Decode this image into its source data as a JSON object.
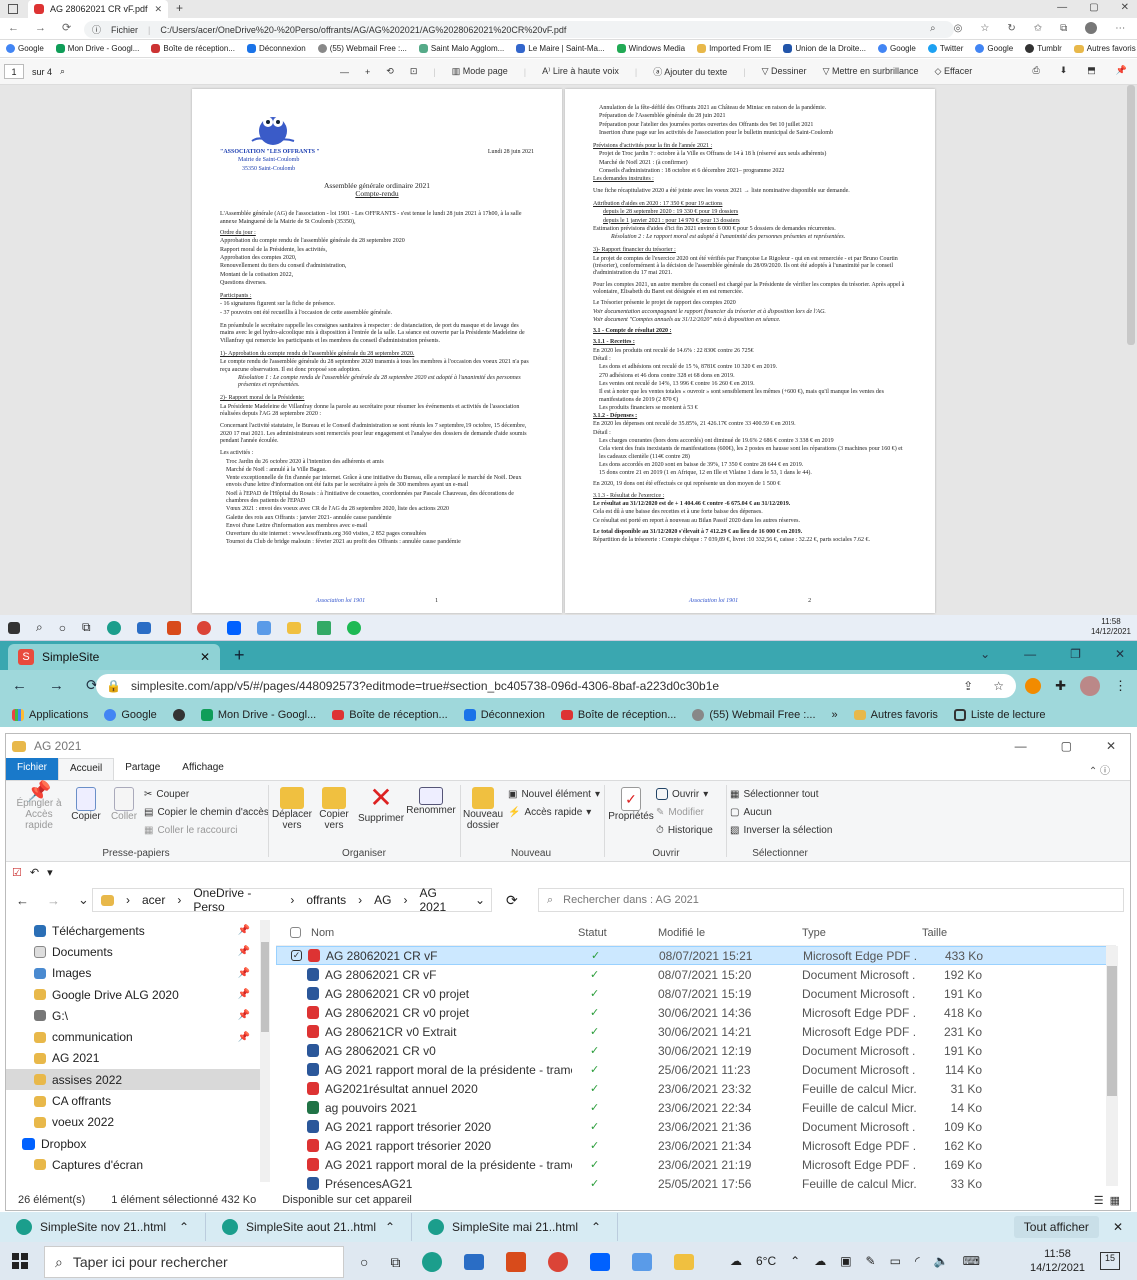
{
  "edge_window": {
    "tab_title": "AG 28062021 CR vF.pdf",
    "address_prefix": "Fichier",
    "url": "C:/Users/acer/OneDrive%20-%20Perso/offrants/AG/AG%202021/AG%2028062021%20CR%20vF.pdf",
    "favorites": [
      "Google",
      "Mon Drive - Googl...",
      "Boîte de réception...",
      "Déconnexion",
      "(55) Webmail Free :...",
      "Saint Malo Agglom...",
      "Le Maire | Saint-Ma...",
      "Windows Media",
      "Imported From IE",
      "Union de la Droite...",
      "Google",
      "Twitter",
      "Google",
      "Tumblr"
    ],
    "favorites_other": "Autres favoris",
    "pdf_toolbar": {
      "page_number": "1",
      "page_of": "sur 4",
      "mode": "Mode page",
      "read_aloud": "Lire à haute voix",
      "add_text": "Ajouter du texte",
      "draw": "Dessiner",
      "highlight": "Mettre en surbrillance",
      "erase": "Effacer"
    },
    "taskbar_time": "11:58",
    "taskbar_date": "14/12/2021"
  },
  "pdf_page1": {
    "org_name": "\"ASSOCIATION \"LES OFFRANTS \"",
    "org_line2": "Mairie de Saint-Coulomb",
    "org_line3": "35350  Saint-Coulomb",
    "date": "Lundi 28 juin 2021",
    "title": "Assemblée générale ordinaire 2021",
    "subtitle": "Compte-rendu",
    "intro": "L'Assemblée générale (AG) de l'association - loi 1901 - Les OFFRANTS - s'est tenue le lundi 28 juin 2021 à 17h00, à la salle annexe Mainguené de la Mairie de St Coulomb (35350),",
    "agenda_title": "Ordre du jour :",
    "agenda": [
      "Approbation du compte rendu de l'assemblée générale du 28 septembre 2020",
      "Rapport moral de la Présidente, les activités,",
      "Approbation des comptes 2020,",
      "Renouvellement du tiers du conseil d'administration,",
      "Montant de la cotisation 2022,",
      "Questions diverses."
    ],
    "participants_title": "Participants :",
    "participants": [
      "- 16 signatures figurent sur la fiche de présence.",
      "- 37 pouvoirs ont été recueillis à l'occasion de cette assemblée générale."
    ],
    "preamble": "En préambule le secrétaire rappelle les consignes sanitaires à respecter : de distanciation, de port du masque et de lavage des mains avec le gel hydro-alcoolique mis à disposition à l'entrée de la salle. La séance est ouverte par la Présidente Madeleine de Villanfray qui remercie les participants et les membres du conseil d'administration présents.",
    "s1_title": "1)- Approbation du compte rendu de l'assemblée générale du 28 septembre 2020.",
    "s1_text": "Le compte rendu de l'assemblée générale du 28 septembre 2020 transmis à tous les membres à l'occasion des voeux 2021 n'a pas reçu aucune observation. Il est donc proposé son adoption.",
    "s1_resolution": "Résolution 1 : Le compte rendu de l'assemblée générale du 28 septembre 2020 est adopté à l'unanimité des personnes présentes et représentées.",
    "s2_title": "2)- Rapport moral de la Présidente:",
    "s2_text": "La Présidente Madeleine de Villanfray donne la parole au secrétaire pour résumer les événements et activités de l'association réalisées depuis l'AG 28 septembre 2020 :",
    "s2_text2": "Concernant l'activité statutaire, le Bureau et le Conseil d'administration se sont réunis les 7 septembre,19 octobre, 15 décembre, 2020 17 mai 2021. Les administrateurs sont remerciés pour leur engagement et l'analyse des dossiers de demande d'aide soumis pendant l'année écoulée.",
    "activities_title": "Les activités :",
    "activities": [
      "Troc Jardin du 26 octobre 2020 à l'intention des adhérents et amis",
      "Marché de Noël : annulé à la Ville Bague.",
      "Vente exceptionnelle de fin d'année par internet. Grâce à une initiative du Bureau, elle a remplacé le marché de Noël. Deux envois d'une lettre d'information ont été faits par le secrétaire à près de 300 membres ayant un e-mail",
      "Noël à l'EPAD de l'Hôpital du Rosais : à l'initiative de cousettes, coordonnées par Pascale Chauveau, des décorations de chambres des patients de l'EPAD",
      "Vœux 2021 : envoi des voeux avec CR de l'AG du 28 septembre 2020, liste des actions 2020",
      "Galette des rois aux Offrants : janvier 2021- annulée cause pandémie",
      "Envoi d'une Lettre d'information aux membres avec e-mail",
      "Ouverture du site internet : www.lesoffrants.org  360 visites, 2 852 pages consultées",
      "Tournoi du Club de bridge malouin : février 2021 au profit des Offrants : annulée cause pandémie"
    ],
    "footer_left": "Association loi 1901",
    "footer_page": "1"
  },
  "pdf_page2": {
    "top_list": [
      "Annulation de la fête-défilé des Offrants 2021 au Château de Miniac en raison de la pandémie.",
      "Préparation de l'Assemblée générale du 28 juin 2021",
      "Préparation pour l'atelier des journées portes ouvertes des Offrants des 9et 10 juillet 2021",
      "Insertion d'une page sur les activités de l'association pour le bulletin municipal de Saint-Coulomb"
    ],
    "forecast_title": "Prévisions d'activités pour la fin de l'année 2021 :",
    "forecast": [
      "Projet de Troc jardin ? :  octobre à la Ville es Offrans de 14 à 18 h (réservé aux seuls adhérents)",
      "Marché de Noël 2021 : (à confirmer)",
      "Conseils d'administration : 18 octobre et 6 décembre 2021– programme 2022"
    ],
    "requests_title": "Les demandes instruites :",
    "requests_text": "Une fiche récapitulative 2020 a été jointe avec les voeux 2021 → liste nominative disponible sur  demande.",
    "aid_line": "Attribution d'aides en 2020 :         17 350 € pour 19 actions",
    "aid_a": "depuis le 28 septembre 2020 : 19 330 € pour 19 dossiers",
    "aid_b": "depuis le 1 janvier 2021 : pour 14 970 € pour 13 dossiers",
    "aid_c": "Estimation prévisions d'aides d'ici fin 2021 environ 6 000 € pour 5 dossiers de demandes récurrentes.",
    "resolution2": "Résolution 2 : Le rapport moral est adopté à l'unanimité des personnes présentes et représentées.",
    "s3_title": "3)- Rapport financier du trésorier :",
    "s3_text": "Le projet de comptes de l'exercice 2020 ont été vérifiés par Françoise Le Rigoleur - qui en est remerciée - et par Bruno Courtin (trésorier), conformément à la décision de l'assemblée générale du 28/09/2020. Ils ont été adoptés à l'unanimité par le conseil d'administration du 17 mai 2021.",
    "s3_text2": "Pour les comptes 2021, un autre membre du conseil est chargé par la Présidente de vérifier les comptes du trésorier. Après appel à volontaire, Elisabeth du Baret est désignée et en est remerciée.",
    "s3_text3": "Le Trésorier présente le projet de rapport des comptes 2020",
    "s3_it1": "Voir documentation accompagnant le rapport financier du trésorier et à disposition lors de l'AG.",
    "s3_it2": "Voir document \"Comptes annuels au 31/12/2020\" mis à disposition en séance.",
    "s31_title": "3.1 - Compte de résultat 2020 :",
    "s311_title": "3.1.1 - Recettes :",
    "s311_text": "En 2020 les produits ont reculé de 14.6% : 22 830€ contre 26 725€",
    "detail": "Détail :",
    "recettes": [
      "Les dons et adhésions ont reculé de 15 %, 8781€ contre 10 320 € en 2019.",
      "270 adhésions et 46 dons contre 328 et 68 dons en 2019.",
      "Les ventes ont reculé de 14%, 13 996 € contre 16 260 € en 2019.",
      "Il est à noter que les ventes totales « ouvroir » sont sensiblement les mêmes (+600 €), mais qu'il manque les ventes des manifestations de 2019 (2 870 €)",
      "Les produits financiers se montent à 53 €"
    ],
    "s312_title": "3.1.2 - Dépenses :",
    "s312_text": "En 2020 les dépenses ont reculé de 35.85%, 21 426.17€ contre 33 400.59 € en 2019.",
    "depenses": [
      "Les charges courantes (hors dons accordés) ont diminué de 19.6% 2 686 € contre 3 338 € en 2019",
      "Cela vient des frais inexistants de manifestations (600€), les 2 postes en hausse sont les réparations (3 machines pour 160 €) et les cadeaux clientèle (114€ contre 28)",
      "Les dons accordés en 2020 sont en baisse de 39%, 17 350 € contre 28 644 € en 2019.",
      "15 dons contre 21 en 2019 (1 en Afrique, 12 en Ille et Vilaine 1 dans le 53, 1 dans le 44)."
    ],
    "dons_line": "En 2020, 19 dons ont été effectués ce qui représente un don moyen de 1 500 €",
    "s313_title": "3.1.3 - Résultat de l'exercice :",
    "s313_text": "Le résultat au 31/12/2020 est de + 1 404.46 € contre -6 675.04 € au 31/12/2019.",
    "s313_text2": "Cela est dû à une baisse des recettes et à une forte baisse des dépenses.",
    "s313_text3": "Ce résultat est porté en report à nouveau au Bilan Passif 2020 dans les autres réserves.",
    "total_line": "Le total disponible au 31/12/2020 s'élevait à 7 412.29 € au lieu de 16 000 € en 2019.",
    "repartition": "Répartition de la trésorerie : Compte chèque : 7 039,89 €, livret :10 332,56 €, caisse : 32.22 €, parts sociales 7.62 €.",
    "footer_left": "Association loi 1901",
    "footer_page": "2"
  },
  "chrome_window": {
    "tab_title": "SimpleSite",
    "url": "simplesite.com/app/v5/#/pages/448092573?editmode=true#section_bc405738-096d-4306-8baf-a223d0c30b1e",
    "favorites": [
      "Applications",
      "Google",
      "Mon Drive - Googl...",
      "Boîte de réception...",
      "Déconnexion",
      "Boîte de réception...",
      "(55) Webmail Free :..."
    ],
    "favorites_more": "»",
    "favorites_other": "Autres favoris",
    "reading_list": "Liste de lecture"
  },
  "explorer": {
    "title": "AG 2021",
    "menu_tabs": [
      "Fichier",
      "Accueil",
      "Partage",
      "Affichage"
    ],
    "ribbon": {
      "pin": "Épingler à Accès rapide",
      "copy": "Copier",
      "paste": "Coller",
      "cut": "Couper",
      "copy_path": "Copier le chemin d'accès",
      "paste_shortcut": "Coller le raccourci",
      "group_clipboard": "Presse-papiers",
      "move_to": "Déplacer vers",
      "copy_to": "Copier vers",
      "delete": "Supprimer",
      "rename": "Renommer",
      "group_organize": "Organiser",
      "new_folder": "Nouveau dossier",
      "new_item": "Nouvel élément",
      "quick_access": "Accès rapide",
      "group_new": "Nouveau",
      "properties": "Propriétés",
      "open": "Ouvrir",
      "modify": "Modifier",
      "history": "Historique",
      "group_open": "Ouvrir",
      "select_all": "Sélectionner tout",
      "select_none": "Aucun",
      "invert_selection": "Inverser la sélection",
      "group_select": "Sélectionner"
    },
    "breadcrumb": [
      "acer",
      "OneDrive - Perso",
      "offrants",
      "AG",
      "AG 2021"
    ],
    "search_placeholder": "Rechercher dans : AG 2021",
    "tree": [
      {
        "label": "Téléchargements",
        "icon": "download-icon",
        "pinned": true
      },
      {
        "label": "Documents",
        "icon": "documents-icon",
        "pinned": true
      },
      {
        "label": "Images",
        "icon": "images-icon",
        "pinned": true
      },
      {
        "label": "Google Drive ALG 2020",
        "icon": "folder-icon",
        "pinned": true
      },
      {
        "label": "G:\\",
        "icon": "drive-icon",
        "pinned": true
      },
      {
        "label": "communication",
        "icon": "folder-icon",
        "pinned": true
      },
      {
        "label": "AG 2021",
        "icon": "folder-icon",
        "pinned": false
      },
      {
        "label": "assises 2022",
        "icon": "folder-icon",
        "pinned": false
      },
      {
        "label": "CA offrants",
        "icon": "folder-icon",
        "pinned": false
      },
      {
        "label": "voeux 2022",
        "icon": "folder-icon",
        "pinned": false
      },
      {
        "label": "Dropbox",
        "icon": "dropbox-icon",
        "pinned": false
      },
      {
        "label": "Captures d'écran",
        "icon": "folder-icon",
        "pinned": false
      }
    ],
    "columns": [
      "Nom",
      "Statut",
      "Modifié le",
      "Type",
      "Taille"
    ],
    "files": [
      {
        "name": "AG 28062021 CR vF",
        "kind": "pdf",
        "date": "08/07/2021 15:21",
        "type": "Microsoft Edge PDF ...",
        "size": "433 Ko"
      },
      {
        "name": "AG 28062021 CR vF",
        "kind": "word",
        "date": "08/07/2021 15:20",
        "type": "Document Microsoft ...",
        "size": "192 Ko"
      },
      {
        "name": "AG 28062021 CR v0 projet",
        "kind": "word",
        "date": "08/07/2021 15:19",
        "type": "Document Microsoft ...",
        "size": "191 Ko"
      },
      {
        "name": "AG 28062021 CR v0 projet",
        "kind": "pdf",
        "date": "30/06/2021 14:36",
        "type": "Microsoft Edge PDF ...",
        "size": "418 Ko"
      },
      {
        "name": "AG 280621CR v0 Extrait",
        "kind": "pdf",
        "date": "30/06/2021 14:21",
        "type": "Microsoft Edge PDF ...",
        "size": "231 Ko"
      },
      {
        "name": "AG 28062021 CR v0",
        "kind": "word",
        "date": "30/06/2021 12:19",
        "type": "Document Microsoft ...",
        "size": "191 Ko"
      },
      {
        "name": "AG 2021 rapport moral de la présidente - trame gros",
        "kind": "word",
        "date": "25/06/2021 11:23",
        "type": "Document Microsoft ...",
        "size": "114 Ko"
      },
      {
        "name": "AG2021résultat annuel 2020",
        "kind": "pdf",
        "date": "23/06/2021 23:32",
        "type": "Feuille de calcul Micr...",
        "size": "31 Ko"
      },
      {
        "name": "ag pouvoirs 2021",
        "kind": "excel",
        "date": "23/06/2021 22:34",
        "type": "Feuille de calcul Micr...",
        "size": "14 Ko"
      },
      {
        "name": "AG 2021 rapport trésorier 2020",
        "kind": "word",
        "date": "23/06/2021 21:36",
        "type": "Document Microsoft ...",
        "size": "109 Ko"
      },
      {
        "name": "AG 2021 rapport trésorier 2020",
        "kind": "pdf",
        "date": "23/06/2021 21:34",
        "type": "Microsoft Edge PDF ...",
        "size": "162 Ko"
      },
      {
        "name": "AG 2021 rapport moral de la présidente - trame gros",
        "kind": "pdf",
        "date": "23/06/2021 21:19",
        "type": "Microsoft Edge PDF ...",
        "size": "169 Ko"
      },
      {
        "name": "PrésencesAG21",
        "kind": "word",
        "date": "25/05/2021 17:56",
        "type": "Feuille de calcul Micr...",
        "size": "33 Ko"
      }
    ],
    "status_count": "26 élément(s)",
    "status_selected": "1 élément sélectionné  432 Ko",
    "status_available": "Disponible sur cet appareil"
  },
  "chrome_bottom_tabs": [
    "SimpleSite nov 21..html",
    "SimpleSite aout 21..html",
    "SimpleSite mai 21..html"
  ],
  "show_all": "Tout afficher",
  "taskbar": {
    "search_placeholder": "Taper ici pour rechercher",
    "weather": "6°C",
    "time": "11:58",
    "date": "14/12/2021",
    "notifications": "15"
  }
}
